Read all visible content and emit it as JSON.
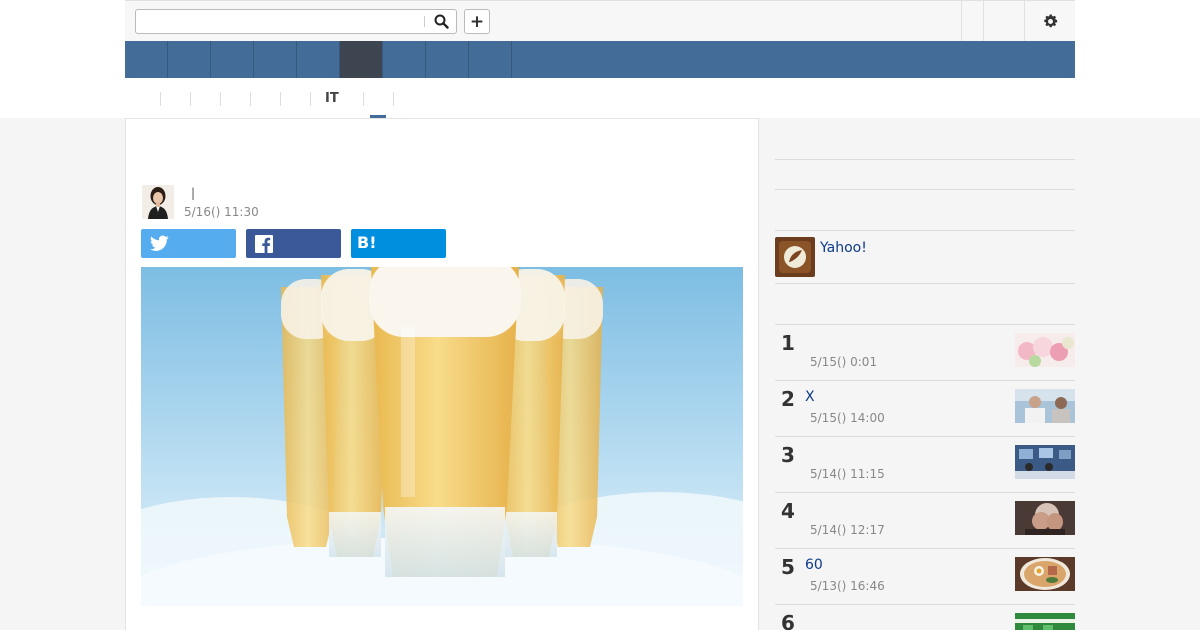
{
  "header": {
    "search": {
      "value": "",
      "placeholder": ""
    },
    "plus_label": "+",
    "icons": {
      "search": "search-icon",
      "settings": "gear-icon"
    }
  },
  "nav": {
    "items": [
      "",
      "",
      "",
      "",
      "",
      "",
      "",
      "",
      ""
    ],
    "active_index": 4
  },
  "subnav": {
    "items": [
      "",
      "",
      "",
      "",
      "",
      "",
      "IT",
      ""
    ],
    "active_index": 6
  },
  "article": {
    "title": "",
    "author_separator": "|",
    "date": "5/16() 11:30",
    "share": {
      "twitter": "",
      "facebook": "",
      "hatena": "B!"
    }
  },
  "sidebar": {
    "yahoo_label": "Yahoo!",
    "ranking": [
      {
        "rank": "1",
        "title": "",
        "date": "5/15() 0:01",
        "thumb": "flowers"
      },
      {
        "rank": "2",
        "title": "X",
        "date": "5/15() 14:00",
        "thumb": "doctor"
      },
      {
        "rank": "3",
        "title": "",
        "date": "5/14() 11:15",
        "thumb": "office"
      },
      {
        "rank": "4",
        "title": "",
        "date": "5/14() 12:17",
        "thumb": "man"
      },
      {
        "rank": "5",
        "title": "60",
        "date": "5/13() 16:46",
        "thumb": "ramen"
      },
      {
        "rank": "6",
        "title": "",
        "date": "",
        "thumb": "green"
      }
    ]
  },
  "colors": {
    "nav": "#436d98",
    "nav_active": "#3d4550",
    "twitter": "#55acee",
    "facebook": "#3b5998",
    "hatena": "#008fde",
    "link": "#0d3a8a"
  }
}
